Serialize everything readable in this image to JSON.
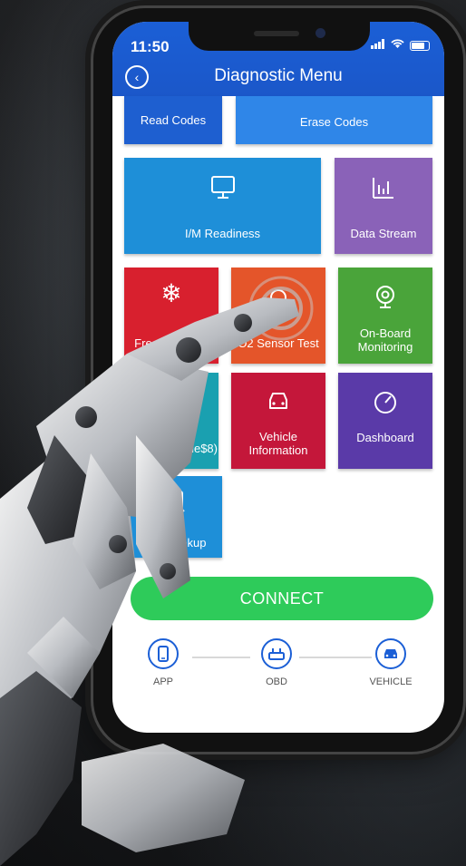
{
  "status": {
    "time": "11:50"
  },
  "header": {
    "title": "Diagnostic Menu",
    "back_icon": "back-arrow-icon"
  },
  "tiles": [
    {
      "label": "Read Codes",
      "color": "#1e5fd0",
      "icon": ""
    },
    {
      "label": "Erase Codes",
      "color": "#2f86e8",
      "icon": ""
    },
    {
      "label": "I/M Readiness",
      "color": "#1e8fd8",
      "icon": "monitor-icon"
    },
    {
      "label": "Data Stream",
      "color": "#8a62b8",
      "icon": "bar-chart-icon"
    },
    {
      "label": "Freeze Frame",
      "color": "#d8202e",
      "icon": "snowflake-icon"
    },
    {
      "label": "O2 Sensor Test",
      "color": "#e4552a",
      "icon": "sensor-icon"
    },
    {
      "label": "On-Board Monitoring",
      "color": "#4aa43a",
      "icon": "webcam-icon"
    },
    {
      "label": "Evap System(mode$8)",
      "color": "#1aa0b0",
      "icon": "evap-icon"
    },
    {
      "label": "Vehicle Information",
      "color": "#c4173a",
      "icon": "car-icon"
    },
    {
      "label": "Dashboard",
      "color": "#5a3aa8",
      "icon": "gauge-icon"
    },
    {
      "label": "DTC Lookup",
      "color": "#1e8fd8",
      "icon": "lookup-icon"
    }
  ],
  "connect_label": "CONNECT",
  "steps": [
    {
      "label": "APP",
      "icon": "phone-icon"
    },
    {
      "label": "OBD",
      "icon": "obd-icon"
    },
    {
      "label": "VEHICLE",
      "icon": "car-icon"
    }
  ],
  "colors": {
    "accent": "#1b5fd6",
    "connect": "#2ecb5a"
  }
}
